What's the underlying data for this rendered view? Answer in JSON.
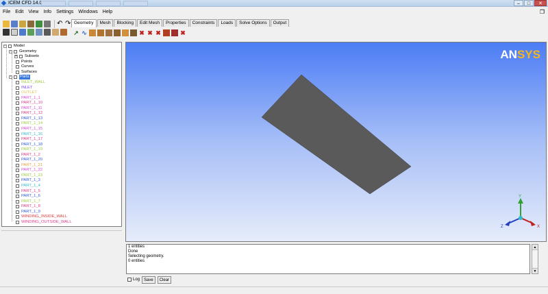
{
  "window": {
    "title": "ICEM CFD 14.0 :",
    "taskbar_items": [
      "",
      "",
      "",
      ""
    ],
    "minimize": "–",
    "maximize": "□",
    "close": "✕"
  },
  "menu": [
    "File",
    "Edit",
    "View",
    "Info",
    "Settings",
    "Windows",
    "Help"
  ],
  "tabs": [
    "Geometry",
    "Mesh",
    "Blocking",
    "Edit Mesh",
    "Properties",
    "Constraints",
    "Loads",
    "Solve Options",
    "Output"
  ],
  "active_tab": "Geometry",
  "tree": {
    "root": "Model",
    "geometry": "Geometry",
    "geometry_children": [
      "Subsets",
      "Points",
      "Curves",
      "Surfaces"
    ],
    "parts_label": "Parts",
    "parts": [
      {
        "name": "INLET_WALL",
        "color": "#9ccc3c"
      },
      {
        "name": "INLET",
        "color": "#7e3ff2"
      },
      {
        "name": "OUTLET",
        "color": "#e0c050"
      },
      {
        "name": "PART_1_1",
        "color": "#d84ad8"
      },
      {
        "name": "PART_1_10",
        "color": "#e03a8a"
      },
      {
        "name": "PART_1_11",
        "color": "#d84ad8"
      },
      {
        "name": "PART_1_12",
        "color": "#e03a8a"
      },
      {
        "name": "PART_1_13",
        "color": "#2f5fe0"
      },
      {
        "name": "PART_1_14",
        "color": "#9ccc3c"
      },
      {
        "name": "PART_1_15",
        "color": "#d84ad8"
      },
      {
        "name": "PART_1_16",
        "color": "#2fbcc8"
      },
      {
        "name": "PART_1_17",
        "color": "#e03a8a"
      },
      {
        "name": "PART_1_18",
        "color": "#2f5fe0"
      },
      {
        "name": "PART_1_19",
        "color": "#9ccc3c"
      },
      {
        "name": "PART_1_2",
        "color": "#e03a8a"
      },
      {
        "name": "PART_1_20",
        "color": "#2f5fe0"
      },
      {
        "name": "PART_1_21",
        "color": "#e8a23a"
      },
      {
        "name": "PART_1_22",
        "color": "#d84ad8"
      },
      {
        "name": "PART_1_23",
        "color": "#9ccc3c"
      },
      {
        "name": "PART_1_3",
        "color": "#2f5fe0"
      },
      {
        "name": "PART_1_4",
        "color": "#2fbcc8"
      },
      {
        "name": "PART_1_5",
        "color": "#e03a8a"
      },
      {
        "name": "PART_1_6",
        "color": "#2f5fe0"
      },
      {
        "name": "PART_1_7",
        "color": "#9ccc3c"
      },
      {
        "name": "PART_1_8",
        "color": "#e03a8a"
      },
      {
        "name": "PART_1_9",
        "color": "#2f5fe0"
      },
      {
        "name": "WINDING_INSIDE_WALL",
        "color": "#e03a3a"
      },
      {
        "name": "WINDING_OUTSIDE_WALL",
        "color": "#e03a8a"
      }
    ]
  },
  "viewport": {
    "logo_an": "AN",
    "logo_sys": "SYS",
    "axis_x": "X",
    "axis_y": "Y",
    "axis_z": "Z",
    "surface_color": "#5a5a5a"
  },
  "messages": [
    "1 entities",
    "Done",
    "Selecting geometry.",
    "0 entities"
  ],
  "msg_controls": {
    "log_label": "Log",
    "save_label": "Save",
    "clear_label": "Clear"
  }
}
